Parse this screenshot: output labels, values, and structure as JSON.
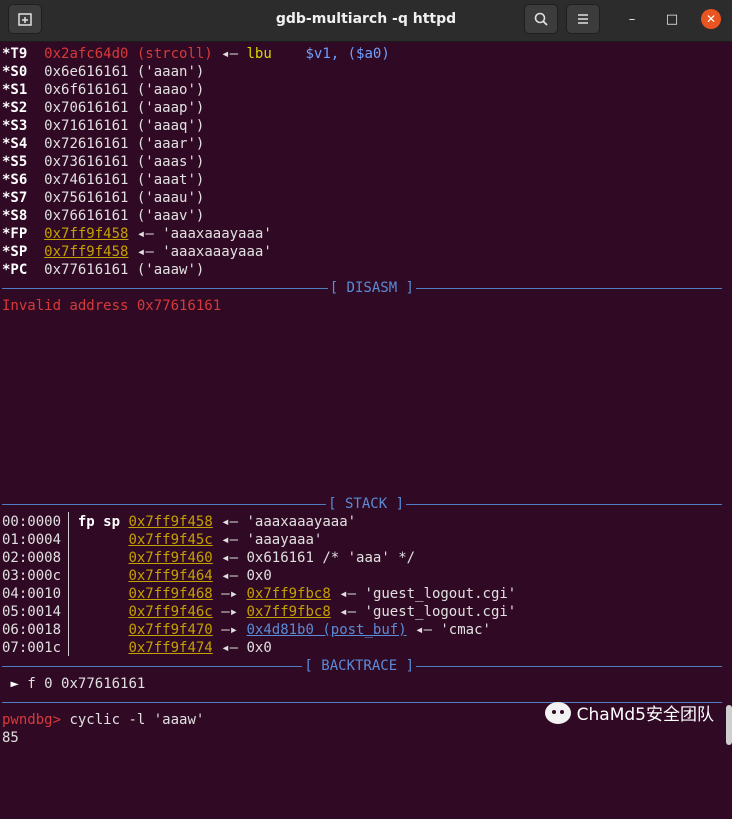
{
  "window": {
    "title": "gdb-multiarch -q httpd",
    "new_tab_icon": "new-tab-icon",
    "search_icon": "search-icon",
    "menu_icon": "hamburger-menu-icon",
    "minimize": "–",
    "maximize": "□",
    "close": "✕"
  },
  "registers": [
    {
      "name": "*T9",
      "value": "0x2afc64d0 (strcoll)",
      "arrow": "◂—",
      "insn": "lbu",
      "operands": "$v1, ($a0)"
    },
    {
      "name": "*S0",
      "value": "0x6e616161 ('aaan')"
    },
    {
      "name": "*S1",
      "value": "0x6f616161 ('aaao')"
    },
    {
      "name": "*S2",
      "value": "0x70616161 ('aaap')"
    },
    {
      "name": "*S3",
      "value": "0x71616161 ('aaaq')"
    },
    {
      "name": "*S4",
      "value": "0x72616161 ('aaar')"
    },
    {
      "name": "*S5",
      "value": "0x73616161 ('aaas')"
    },
    {
      "name": "*S6",
      "value": "0x74616161 ('aaat')"
    },
    {
      "name": "*S7",
      "value": "0x75616161 ('aaau')"
    },
    {
      "name": "*S8",
      "value": "0x76616161 ('aaav')"
    },
    {
      "name": "*FP",
      "addr": "0x7ff9f458",
      "arrow": "◂—",
      "rest": "'aaaxaaayaaa'"
    },
    {
      "name": "*SP",
      "addr": "0x7ff9f458",
      "arrow": "◂—",
      "rest": "'aaaxaaayaaa'"
    },
    {
      "name": "*PC",
      "value": "0x77616161 ('aaaw')"
    }
  ],
  "sections": {
    "disasm": "[ DISASM ]",
    "stack": "[ STACK ]",
    "backtrace": "[ BACKTRACE ]"
  },
  "disasm_error": "Invalid address 0x77616161",
  "stack": [
    {
      "off": "00:0000",
      "tag": "fp sp",
      "addr": "0x7ff9f458",
      "arrow": "◂—",
      "rest": "'aaaxaaayaaa'"
    },
    {
      "off": "01:0004",
      "tag": "",
      "addr": "0x7ff9f45c",
      "arrow": "◂—",
      "rest": "'aaayaaa'"
    },
    {
      "off": "02:0008",
      "tag": "",
      "addr": "0x7ff9f460",
      "arrow": "◂—",
      "rest": "0x616161 /* 'aaa' */"
    },
    {
      "off": "03:000c",
      "tag": "",
      "addr": "0x7ff9f464",
      "arrow": "◂—",
      "rest": "0x0"
    },
    {
      "off": "04:0010",
      "tag": "",
      "addr": "0x7ff9f468",
      "arrow": "—▸",
      "ptr": "0x7ff9fbc8",
      "arrow2": "◂—",
      "rest": "'guest_logout.cgi'"
    },
    {
      "off": "05:0014",
      "tag": "",
      "addr": "0x7ff9f46c",
      "arrow": "—▸",
      "ptr": "0x7ff9fbc8",
      "arrow2": "◂—",
      "rest": "'guest_logout.cgi'"
    },
    {
      "off": "06:0018",
      "tag": "",
      "addr": "0x7ff9f470",
      "arrow": "—▸",
      "ptr": "0x4d81b0 (post_buf)",
      "arrow2": "◂—",
      "rest": "'cmac'"
    },
    {
      "off": "07:001c",
      "tag": "",
      "addr": "0x7ff9f474",
      "arrow": "◂—",
      "rest": "0x0"
    }
  ],
  "backtrace": {
    "marker": "►",
    "frame": "f 0",
    "addr": "0x77616161"
  },
  "prompt": {
    "name": "pwndbg>",
    "command": "cyclic -l 'aaaw'"
  },
  "output": "85",
  "watermark": {
    "text": "ChaMd5安全团队",
    "icon": "wechat-icon"
  }
}
